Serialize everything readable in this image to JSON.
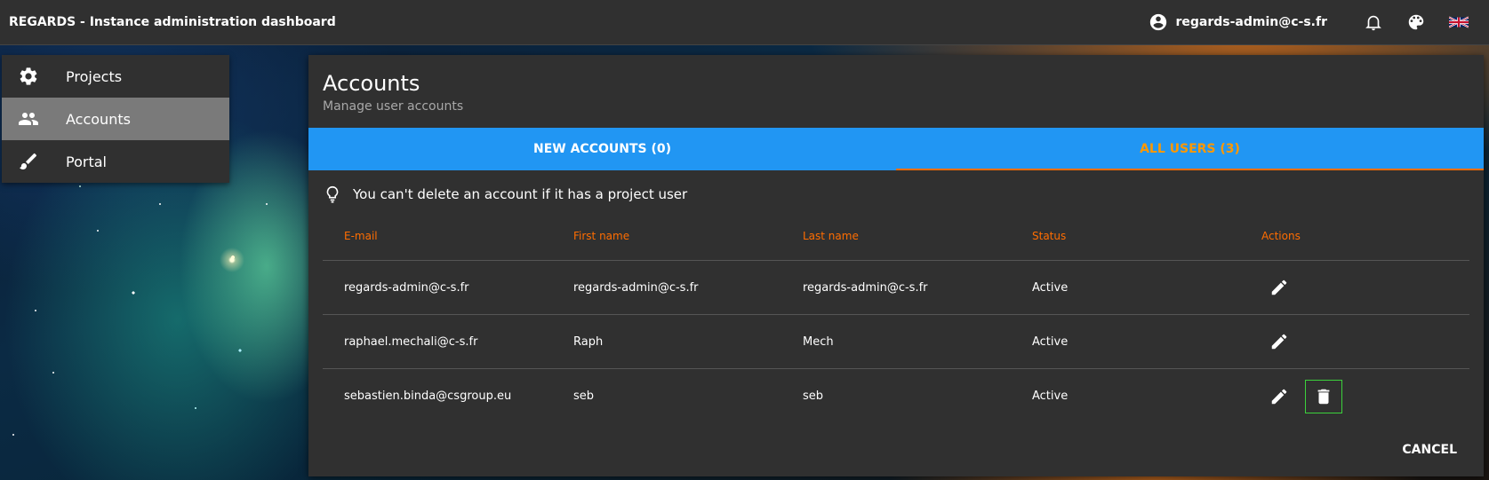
{
  "topbar": {
    "title": "REGARDS - Instance administration dashboard",
    "user_email": "regards-admin@c-s.fr",
    "icons": [
      "account-circle-icon",
      "notifications-icon",
      "palette-icon",
      "uk-flag-icon"
    ]
  },
  "sidebar": {
    "items": [
      {
        "label": "Projects",
        "icon": "gear-icon",
        "active": false
      },
      {
        "label": "Accounts",
        "icon": "people-icon",
        "active": true
      },
      {
        "label": "Portal",
        "icon": "brush-icon",
        "active": false
      }
    ]
  },
  "card": {
    "title": "Accounts",
    "subtitle": "Manage user accounts",
    "tabs": [
      {
        "label": "NEW ACCOUNTS (0)",
        "selected": false
      },
      {
        "label": "ALL USERS (3)",
        "selected": true
      }
    ],
    "hint": "You can't delete an account if it has a project user",
    "columns": [
      "E-mail",
      "First name",
      "Last name",
      "Status",
      "Actions"
    ],
    "rows": [
      {
        "email": "regards-admin@c-s.fr",
        "first_name": "regards-admin@c-s.fr",
        "last_name": "regards-admin@c-s.fr",
        "status": "Active",
        "can_delete": false
      },
      {
        "email": "raphael.mechali@c-s.fr",
        "first_name": "Raph",
        "last_name": "Mech",
        "status": "Active",
        "can_delete": false
      },
      {
        "email": "sebastien.binda@csgroup.eu",
        "first_name": "seb",
        "last_name": "seb",
        "status": "Active",
        "can_delete": true
      }
    ],
    "cancel_label": "CANCEL"
  },
  "colors": {
    "accent": "#ff6d00",
    "tab_bar": "#2196f3",
    "surface": "#303030"
  }
}
